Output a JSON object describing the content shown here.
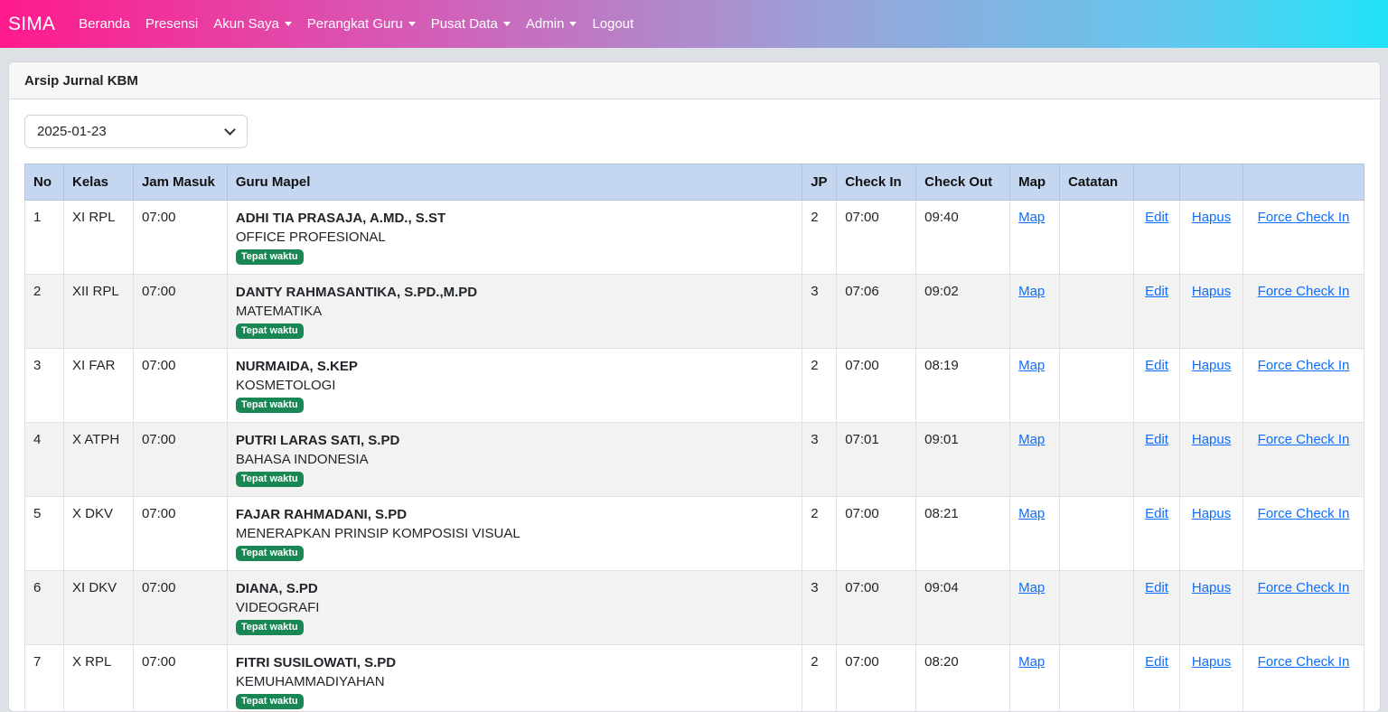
{
  "nav": {
    "brand": "SIMA",
    "items": [
      "Beranda",
      "Presensi",
      "Akun Saya",
      "Perangkat Guru",
      "Pusat Data",
      "Admin",
      "Logout"
    ]
  },
  "card": {
    "title": "Arsip Jurnal KBM"
  },
  "filter": {
    "date": "2025-01-23"
  },
  "table": {
    "headers": [
      "No",
      "Kelas",
      "Jam Masuk",
      "Guru Mapel",
      "JP",
      "Check In",
      "Check Out",
      "Map",
      "Catatan",
      "",
      "",
      ""
    ],
    "link_labels": {
      "map": "Map",
      "edit": "Edit",
      "hapus": "Hapus",
      "force": "Force Check In"
    },
    "rows": [
      {
        "no": "1",
        "kelas": "XI RPL",
        "jam": "07:00",
        "guru": "ADHI TIA PRASAJA, A.MD., S.ST",
        "mapel": "OFFICE PROFESIONAL",
        "badge": "Tepat waktu",
        "jp": "2",
        "in": "07:00",
        "out": "09:40",
        "catatan": ""
      },
      {
        "no": "2",
        "kelas": "XII RPL",
        "jam": "07:00",
        "guru": "DANTY RAHMASANTIKA, S.PD.,M.PD",
        "mapel": "MATEMATIKA",
        "badge": "Tepat waktu",
        "jp": "3",
        "in": "07:06",
        "out": "09:02",
        "catatan": ""
      },
      {
        "no": "3",
        "kelas": "XI FAR",
        "jam": "07:00",
        "guru": "NURMAIDA, S.KEP",
        "mapel": "KOSMETOLOGI",
        "badge": "Tepat waktu",
        "jp": "2",
        "in": "07:00",
        "out": "08:19",
        "catatan": ""
      },
      {
        "no": "4",
        "kelas": "X ATPH",
        "jam": "07:00",
        "guru": "PUTRI LARAS SATI, S.PD",
        "mapel": "BAHASA INDONESIA",
        "badge": "Tepat waktu",
        "jp": "3",
        "in": "07:01",
        "out": "09:01",
        "catatan": ""
      },
      {
        "no": "5",
        "kelas": "X DKV",
        "jam": "07:00",
        "guru": "FAJAR RAHMADANI, S.PD",
        "mapel": "MENERAPKAN PRINSIP KOMPOSISI VISUAL",
        "badge": "Tepat waktu",
        "jp": "2",
        "in": "07:00",
        "out": "08:21",
        "catatan": ""
      },
      {
        "no": "6",
        "kelas": "XI DKV",
        "jam": "07:00",
        "guru": "DIANA, S.PD",
        "mapel": "VIDEOGRAFI",
        "badge": "Tepat waktu",
        "jp": "3",
        "in": "07:00",
        "out": "09:04",
        "catatan": ""
      },
      {
        "no": "7",
        "kelas": "X RPL",
        "jam": "07:00",
        "guru": "FITRI SUSILOWATI, S.PD",
        "mapel": "KEMUHAMMADIYAHAN",
        "badge": "Tepat waktu",
        "jp": "2",
        "in": "07:00",
        "out": "08:20",
        "catatan": ""
      }
    ]
  }
}
